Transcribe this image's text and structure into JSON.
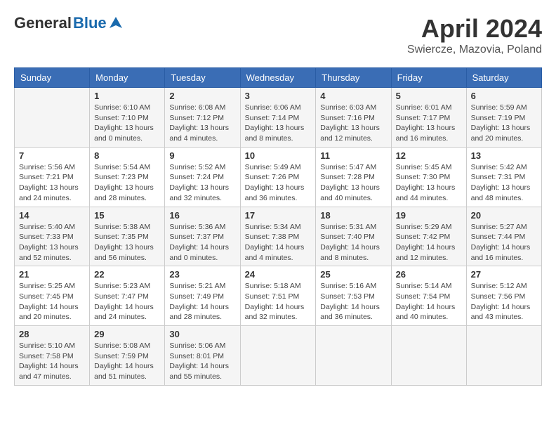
{
  "header": {
    "logo_general": "General",
    "logo_blue": "Blue",
    "title": "April 2024",
    "location": "Swiercze, Mazovia, Poland"
  },
  "weekdays": [
    "Sunday",
    "Monday",
    "Tuesday",
    "Wednesday",
    "Thursday",
    "Friday",
    "Saturday"
  ],
  "weeks": [
    [
      {
        "day": "",
        "info": ""
      },
      {
        "day": "1",
        "info": "Sunrise: 6:10 AM\nSunset: 7:10 PM\nDaylight: 13 hours\nand 0 minutes."
      },
      {
        "day": "2",
        "info": "Sunrise: 6:08 AM\nSunset: 7:12 PM\nDaylight: 13 hours\nand 4 minutes."
      },
      {
        "day": "3",
        "info": "Sunrise: 6:06 AM\nSunset: 7:14 PM\nDaylight: 13 hours\nand 8 minutes."
      },
      {
        "day": "4",
        "info": "Sunrise: 6:03 AM\nSunset: 7:16 PM\nDaylight: 13 hours\nand 12 minutes."
      },
      {
        "day": "5",
        "info": "Sunrise: 6:01 AM\nSunset: 7:17 PM\nDaylight: 13 hours\nand 16 minutes."
      },
      {
        "day": "6",
        "info": "Sunrise: 5:59 AM\nSunset: 7:19 PM\nDaylight: 13 hours\nand 20 minutes."
      }
    ],
    [
      {
        "day": "7",
        "info": "Sunrise: 5:56 AM\nSunset: 7:21 PM\nDaylight: 13 hours\nand 24 minutes."
      },
      {
        "day": "8",
        "info": "Sunrise: 5:54 AM\nSunset: 7:23 PM\nDaylight: 13 hours\nand 28 minutes."
      },
      {
        "day": "9",
        "info": "Sunrise: 5:52 AM\nSunset: 7:24 PM\nDaylight: 13 hours\nand 32 minutes."
      },
      {
        "day": "10",
        "info": "Sunrise: 5:49 AM\nSunset: 7:26 PM\nDaylight: 13 hours\nand 36 minutes."
      },
      {
        "day": "11",
        "info": "Sunrise: 5:47 AM\nSunset: 7:28 PM\nDaylight: 13 hours\nand 40 minutes."
      },
      {
        "day": "12",
        "info": "Sunrise: 5:45 AM\nSunset: 7:30 PM\nDaylight: 13 hours\nand 44 minutes."
      },
      {
        "day": "13",
        "info": "Sunrise: 5:42 AM\nSunset: 7:31 PM\nDaylight: 13 hours\nand 48 minutes."
      }
    ],
    [
      {
        "day": "14",
        "info": "Sunrise: 5:40 AM\nSunset: 7:33 PM\nDaylight: 13 hours\nand 52 minutes."
      },
      {
        "day": "15",
        "info": "Sunrise: 5:38 AM\nSunset: 7:35 PM\nDaylight: 13 hours\nand 56 minutes."
      },
      {
        "day": "16",
        "info": "Sunrise: 5:36 AM\nSunset: 7:37 PM\nDaylight: 14 hours\nand 0 minutes."
      },
      {
        "day": "17",
        "info": "Sunrise: 5:34 AM\nSunset: 7:38 PM\nDaylight: 14 hours\nand 4 minutes."
      },
      {
        "day": "18",
        "info": "Sunrise: 5:31 AM\nSunset: 7:40 PM\nDaylight: 14 hours\nand 8 minutes."
      },
      {
        "day": "19",
        "info": "Sunrise: 5:29 AM\nSunset: 7:42 PM\nDaylight: 14 hours\nand 12 minutes."
      },
      {
        "day": "20",
        "info": "Sunrise: 5:27 AM\nSunset: 7:44 PM\nDaylight: 14 hours\nand 16 minutes."
      }
    ],
    [
      {
        "day": "21",
        "info": "Sunrise: 5:25 AM\nSunset: 7:45 PM\nDaylight: 14 hours\nand 20 minutes."
      },
      {
        "day": "22",
        "info": "Sunrise: 5:23 AM\nSunset: 7:47 PM\nDaylight: 14 hours\nand 24 minutes."
      },
      {
        "day": "23",
        "info": "Sunrise: 5:21 AM\nSunset: 7:49 PM\nDaylight: 14 hours\nand 28 minutes."
      },
      {
        "day": "24",
        "info": "Sunrise: 5:18 AM\nSunset: 7:51 PM\nDaylight: 14 hours\nand 32 minutes."
      },
      {
        "day": "25",
        "info": "Sunrise: 5:16 AM\nSunset: 7:53 PM\nDaylight: 14 hours\nand 36 minutes."
      },
      {
        "day": "26",
        "info": "Sunrise: 5:14 AM\nSunset: 7:54 PM\nDaylight: 14 hours\nand 40 minutes."
      },
      {
        "day": "27",
        "info": "Sunrise: 5:12 AM\nSunset: 7:56 PM\nDaylight: 14 hours\nand 43 minutes."
      }
    ],
    [
      {
        "day": "28",
        "info": "Sunrise: 5:10 AM\nSunset: 7:58 PM\nDaylight: 14 hours\nand 47 minutes."
      },
      {
        "day": "29",
        "info": "Sunrise: 5:08 AM\nSunset: 7:59 PM\nDaylight: 14 hours\nand 51 minutes."
      },
      {
        "day": "30",
        "info": "Sunrise: 5:06 AM\nSunset: 8:01 PM\nDaylight: 14 hours\nand 55 minutes."
      },
      {
        "day": "",
        "info": ""
      },
      {
        "day": "",
        "info": ""
      },
      {
        "day": "",
        "info": ""
      },
      {
        "day": "",
        "info": ""
      }
    ]
  ]
}
